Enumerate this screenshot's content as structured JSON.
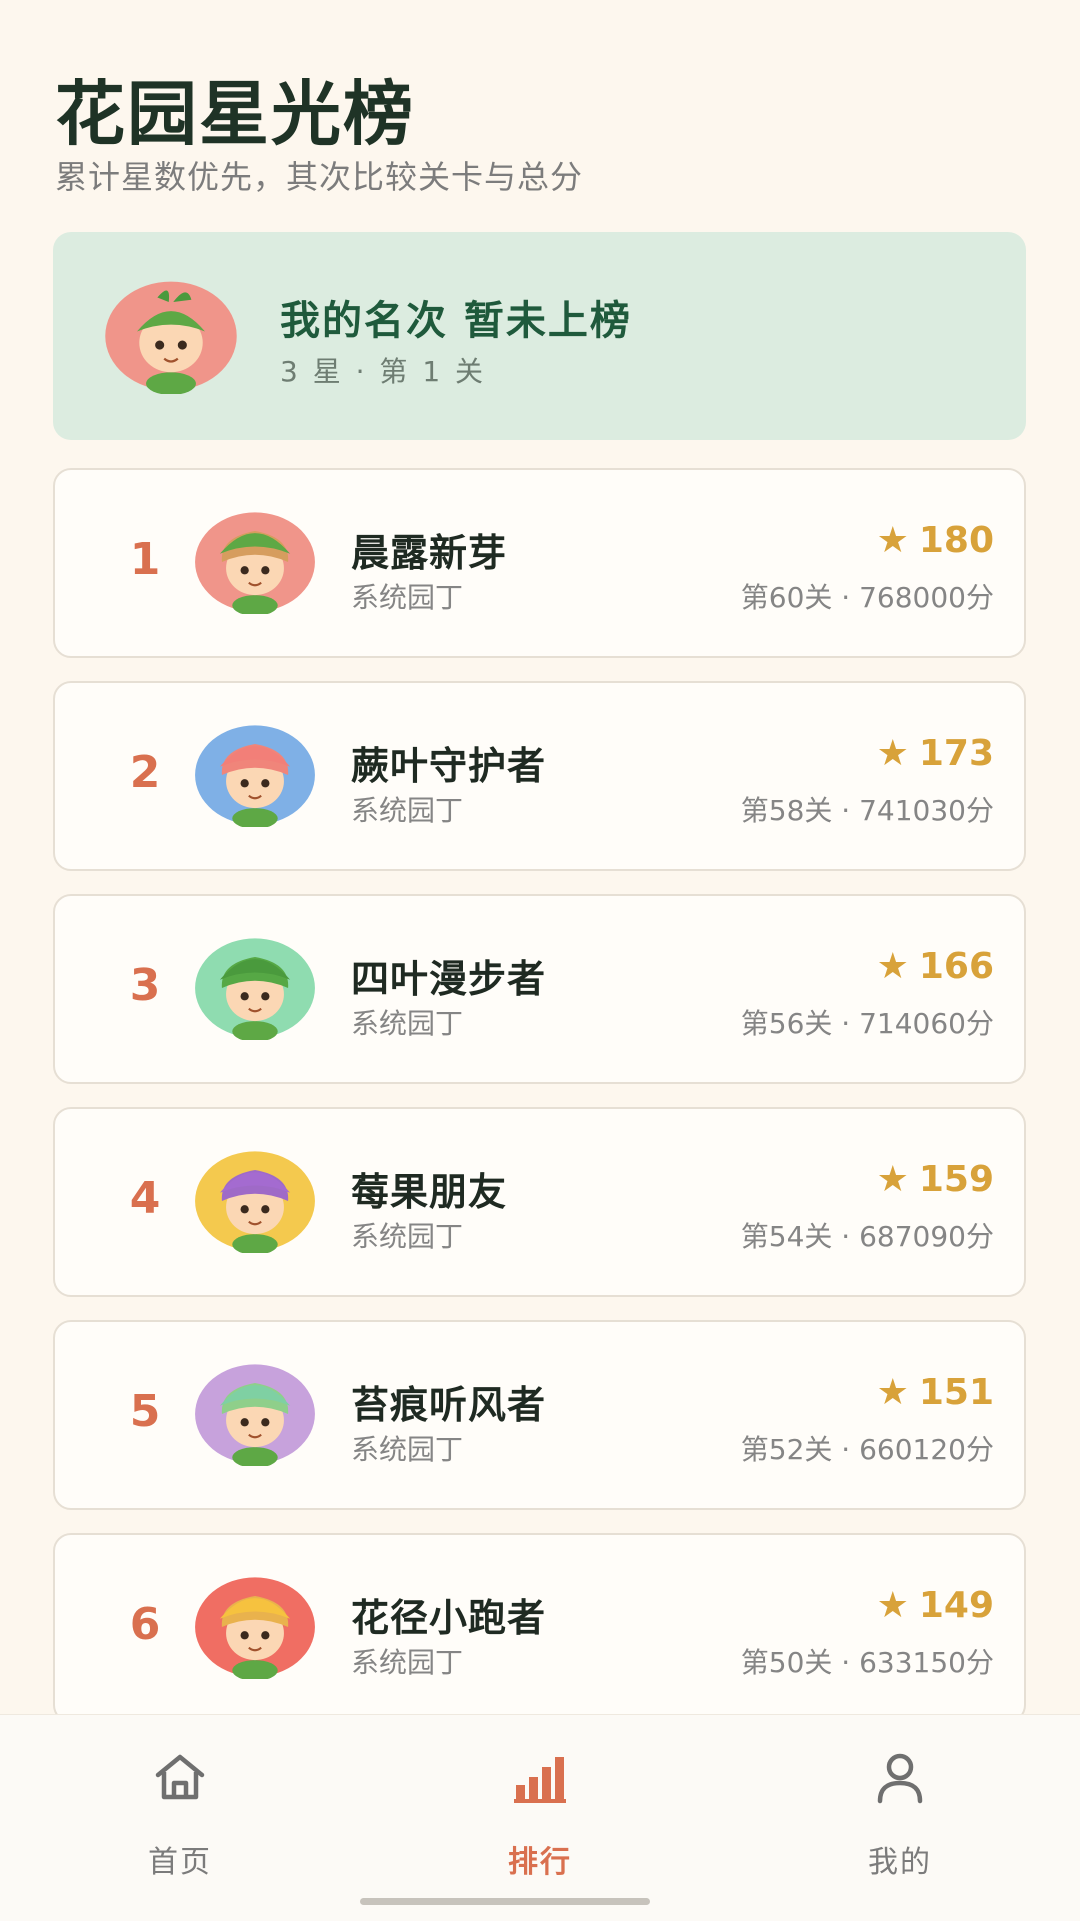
{
  "header": {
    "title": "花园星光榜",
    "subtitle": "累计星数优先，其次比较关卡与总分"
  },
  "my_card": {
    "rank_text": "我的名次 暂未上榜",
    "stats_text": "3 星 · 第 1 关",
    "avatar": "leaf-sprout-avatar"
  },
  "leaderboard": [
    {
      "rank": "1",
      "name": "晨露新芽",
      "tag": "系统园丁",
      "stars": "180",
      "meta": "第60关 · 768000分",
      "avatar": "leaf-sprout-avatar",
      "bg": "#f0958a",
      "hat": "#5ea845",
      "hair": "#d69d5e"
    },
    {
      "rank": "2",
      "name": "蕨叶守护者",
      "tag": "系统园丁",
      "stars": "173",
      "meta": "第58关 · 741030分",
      "avatar": "pink-flower-avatar",
      "bg": "#7fb0e6",
      "hat": "#f27f78",
      "hair": "#f0857a"
    },
    {
      "rank": "3",
      "name": "四叶漫步者",
      "tag": "系统园丁",
      "stars": "166",
      "meta": "第56关 · 714060分",
      "avatar": "blueberry-avatar",
      "bg": "#8fdcb0",
      "hat": "#4a9a3d",
      "hair": "#56a845"
    },
    {
      "rank": "4",
      "name": "莓果朋友",
      "tag": "系统园丁",
      "stars": "159",
      "meta": "第54关 · 687090分",
      "avatar": "mushroom-avatar",
      "bg": "#f4c94e",
      "hat": "#a46bd0",
      "hair": "#9f6ac7"
    },
    {
      "rank": "5",
      "name": "苔痕听风者",
      "tag": "系统园丁",
      "stars": "151",
      "meta": "第52关 · 660120分",
      "avatar": "moss-hood-avatar",
      "bg": "#c7a2dc",
      "hat": "#7fd0a3",
      "hair": "#8fcf8a"
    },
    {
      "rank": "6",
      "name": "花径小跑者",
      "tag": "系统园丁",
      "stars": "149",
      "meta": "第50关 · 633150分",
      "avatar": "sunflower-avatar",
      "bg": "#f06e63",
      "hat": "#f6c23f",
      "hair": "#e9b24d"
    }
  ],
  "tabbar": {
    "home": {
      "label": "首页",
      "icon": "home-icon"
    },
    "ranking": {
      "label": "排行",
      "icon": "bar-chart-icon"
    },
    "profile": {
      "label": "我的",
      "icon": "user-icon"
    }
  },
  "colors": {
    "accent": "#d9704f",
    "star": "#d8a23a",
    "background": "#fdf7ee",
    "my_card_bg": "#dcece0"
  }
}
